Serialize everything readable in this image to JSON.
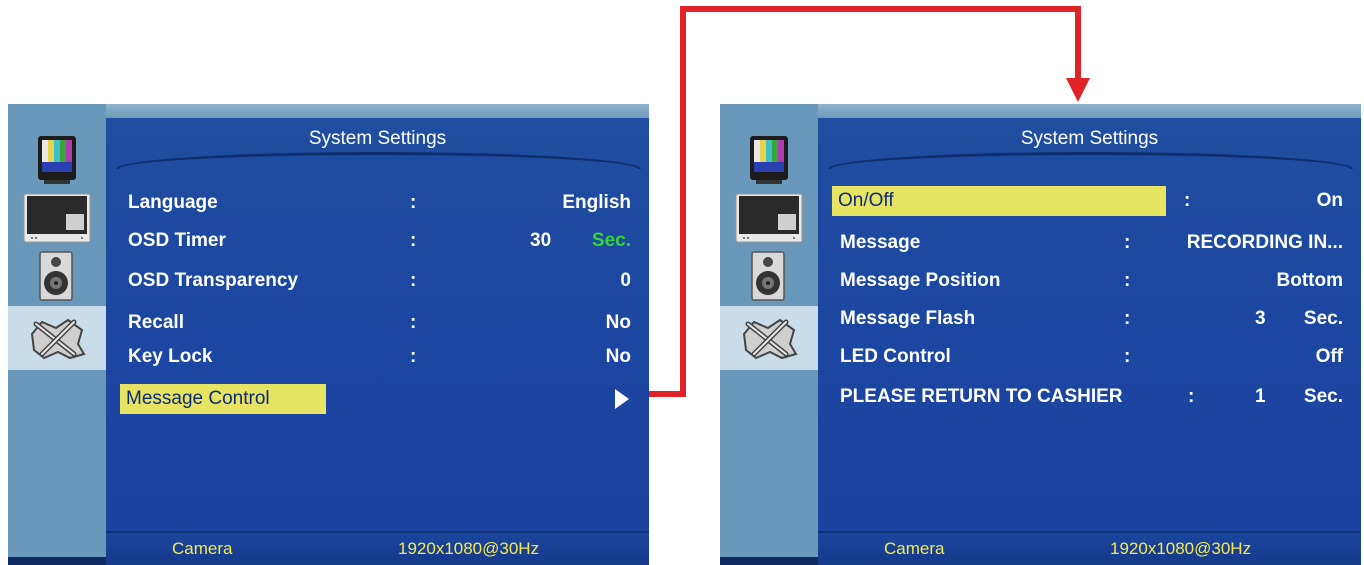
{
  "left_panel": {
    "title": "System Settings",
    "rows": [
      {
        "label": "Language",
        "colon": ":",
        "value": "English"
      },
      {
        "label": "OSD Timer",
        "colon": ":",
        "number": "30",
        "unit": "Sec."
      },
      {
        "label": "OSD Transparency",
        "colon": ":",
        "value": "0"
      },
      {
        "label": "Recall",
        "colon": ":",
        "value": "No"
      },
      {
        "label": "Key Lock",
        "colon": ":",
        "value": "No"
      }
    ],
    "selected_item": "Message Control",
    "footer": {
      "source": "Camera",
      "resolution": "1920x1080@30Hz"
    }
  },
  "right_panel": {
    "title": "System Settings",
    "selected_row": {
      "label": "On/Off",
      "colon": ":",
      "value": "On"
    },
    "rows": [
      {
        "label": "Message",
        "colon": ":",
        "value": "RECORDING IN..."
      },
      {
        "label": "Message Position",
        "colon": ":",
        "value": "Bottom"
      },
      {
        "label": "Message Flash",
        "colon": ":",
        "number": "3",
        "unit": "Sec."
      },
      {
        "label": "LED Control",
        "colon": ":",
        "value": "Off"
      },
      {
        "label": "PLEASE RETURN TO CASHIER",
        "colon": ":",
        "number": "1",
        "unit": "Sec."
      }
    ],
    "footer": {
      "source": "Camera",
      "resolution": "1920x1080@30Hz"
    }
  },
  "sidebar_icons": [
    "tv-color-bars-icon",
    "monitor-pip-icon",
    "speaker-icon",
    "tools-gear-icon"
  ],
  "colors": {
    "panel_blue": "#1c47a0",
    "sidebar": "#6a98ba",
    "highlight": "#e6e462",
    "footer_text": "#f3ea52",
    "unit_green": "#3bd13b",
    "connector_red": "#e02326"
  }
}
